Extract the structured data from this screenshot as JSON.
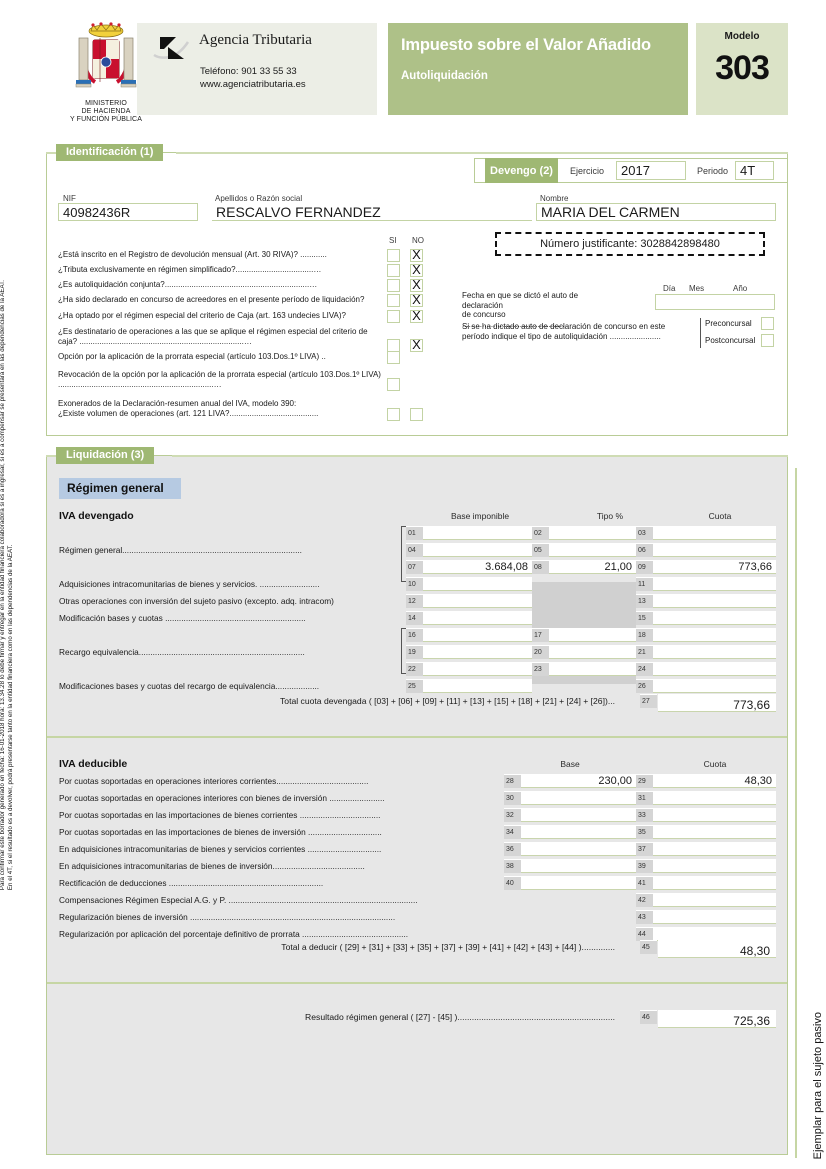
{
  "header": {
    "ministry": "MINISTERIO\nDE HACIENDA\nY FUNCIÓN PÚBLICA",
    "agency_name": "Agencia Tributaria",
    "agency_phone": "Teléfono: 901 33 55 33",
    "agency_web": "www.agenciatributaria.es",
    "title_main": "Impuesto sobre el Valor Añadido",
    "title_sub": "Autoliquidación",
    "modelo_label": "Modelo",
    "modelo_number": "303"
  },
  "identification": {
    "tab": "Identificación (1)",
    "nif_label": "NIF",
    "nif_value": "40982436R",
    "apellidos_label": "Apellidos o Razón social",
    "apellidos_value": "RESCALVO FERNANDEZ",
    "nombre_label": "Nombre",
    "nombre_value": "MARIA DEL CARMEN",
    "justificante": "Número justificante: 3028842898480",
    "si_label": "SI",
    "no_label": "NO",
    "questions": [
      {
        "text": "¿Está inscrito en el Registro de devolución mensual (Art. 30 RIVA)? ............",
        "si": "",
        "no": "X"
      },
      {
        "text": "¿Tributa exclusivamente en régimen simplificado?...................................…",
        "si": "",
        "no": "X"
      },
      {
        "text": "¿Es autoliquidación conjunta?.................................................................…",
        "si": "",
        "no": "X"
      },
      {
        "text": "¿Ha sido declarado en concurso de acreedores en el presente período de liquidación?",
        "si": "",
        "no": "X"
      },
      {
        "text": "¿Ha optado por el régimen especial del criterio de Caja (art. 163 undecies LIVA)?",
        "si": "",
        "no": "X"
      },
      {
        "text": "¿Es destinatario de operaciones a las que se aplique el régimen especial del criterio de caja? ..........................................................................…",
        "si": "",
        "no": "X"
      },
      {
        "text": "Opción por la aplicación de la prorrata especial (artículo 103.Dos.1º LIVA) ..",
        "si": "",
        "no": null
      },
      {
        "text": "Revocación de la opción por la aplicación de la prorrata especial (artículo 103.Dos.1º LIVA) ......................................................................…",
        "si": "",
        "no": null
      },
      {
        "text": "Exonerados de la Declaración-resumen anual del IVA, modelo 390:\n¿Existe volumen de operaciones (art. 121 LIVA?........................................",
        "si": "",
        "no": ""
      }
    ],
    "concurso_fecha_label": "Fecha en que se dictó el auto de declaración\nde concurso ..............................................",
    "dia_label": "Día",
    "mes_label": "Mes",
    "anio_label": "Año",
    "concurso_fecha_value": "",
    "concurso_tipo_label": "Si se ha dictado auto de declaración de concurso en este\nperíodo indique el tipo de autoliquidación .......................",
    "preconcursal_label": "Preconcursal",
    "postconcursal_label": "Postconcursal",
    "preconcursal_value": "",
    "postconcursal_value": ""
  },
  "devengo": {
    "tab": "Devengo (2)",
    "ejercicio_label": "Ejercicio",
    "ejercicio_value": "2017",
    "periodo_label": "Periodo",
    "periodo_value": "4T"
  },
  "liquidacion": {
    "tab": "Liquidación (3)",
    "regimen_general_header": "Régimen general",
    "devengado": {
      "title": "IVA devengado",
      "col_base": "Base imponible",
      "col_tipo": "Tipo %",
      "col_cuota": "Cuota",
      "rows": [
        {
          "label": "",
          "base_num": "01",
          "base": "",
          "tipo_num": "02",
          "tipo": "",
          "cuota_num": "03",
          "cuota": ""
        },
        {
          "label": "Régimen general..............................................................................",
          "base_num": "04",
          "base": "",
          "tipo_num": "05",
          "tipo": "",
          "cuota_num": "06",
          "cuota": ""
        },
        {
          "label": "",
          "base_num": "07",
          "base": "3.684,08",
          "tipo_num": "08",
          "tipo": "21,00",
          "cuota_num": "09",
          "cuota": "773,66"
        },
        {
          "label": "Adquisiciones intracomunitarias de bienes y servicios. ..........................",
          "base_num": "10",
          "base": "",
          "tipo_num": "",
          "tipo": "",
          "cuota_num": "11",
          "cuota": ""
        },
        {
          "label": "Otras operaciones con inversión del sujeto pasivo (excepto. adq. intracom)",
          "base_num": "12",
          "base": "",
          "tipo_num": "",
          "tipo": "",
          "cuota_num": "13",
          "cuota": ""
        },
        {
          "label": "Modificación bases y cuotas .............................................................",
          "base_num": "14",
          "base": "",
          "tipo_num": "",
          "tipo": "",
          "cuota_num": "15",
          "cuota": ""
        },
        {
          "label": "",
          "base_num": "16",
          "base": "",
          "tipo_num": "17",
          "tipo": "",
          "cuota_num": "18",
          "cuota": ""
        },
        {
          "label": "Recargo equivalencia........................................................................",
          "base_num": "19",
          "base": "",
          "tipo_num": "20",
          "tipo": "",
          "cuota_num": "21",
          "cuota": ""
        },
        {
          "label": "",
          "base_num": "22",
          "base": "",
          "tipo_num": "23",
          "tipo": "",
          "cuota_num": "24",
          "cuota": ""
        },
        {
          "label": "Modificaciones bases y cuotas del recargo de equivalencia...................",
          "base_num": "25",
          "base": "",
          "tipo_num": "",
          "tipo": "",
          "cuota_num": "26",
          "cuota": ""
        }
      ],
      "total_label": "Total cuota devengada ( [03] + [06] + [09] + [11] + [13] + [15] + [18] + [21] + [24] + [26])...",
      "total_num": "27",
      "total_value": "773,66"
    },
    "deducible": {
      "title": "IVA deducible",
      "col_base": "Base",
      "col_cuota": "Cuota",
      "rows": [
        {
          "label": "Por cuotas soportadas en operaciones interiores corrientes........................................",
          "base_num": "28",
          "base": "230,00",
          "cuota_num": "29",
          "cuota": "48,30"
        },
        {
          "label": "Por cuotas soportadas en operaciones interiores con bienes de inversión ........................",
          "base_num": "30",
          "base": "",
          "cuota_num": "31",
          "cuota": ""
        },
        {
          "label": "Por cuotas soportadas en las importaciones de bienes corrientes ...................................",
          "base_num": "32",
          "base": "",
          "cuota_num": "33",
          "cuota": ""
        },
        {
          "label": "Por cuotas soportadas en las importaciones de bienes de inversión ................................",
          "base_num": "34",
          "base": "",
          "cuota_num": "35",
          "cuota": ""
        },
        {
          "label": "En adquisiciones intracomunitarias de bienes y servicios corrientes ................................",
          "base_num": "36",
          "base": "",
          "cuota_num": "37",
          "cuota": ""
        },
        {
          "label": "En adquisiciones intracomunitarias de bienes de inversión........................................",
          "base_num": "38",
          "base": "",
          "cuota_num": "39",
          "cuota": ""
        },
        {
          "label": "Rectificación de deducciones ...................................................................",
          "base_num": "40",
          "base": "",
          "cuota_num": "41",
          "cuota": ""
        },
        {
          "label": "Compensaciones Régimen Especial A.G. y P. ..................................................................................",
          "base_num": "",
          "base": "",
          "cuota_num": "42",
          "cuota": ""
        },
        {
          "label": "Regularización bienes de inversión .........................................................................................",
          "base_num": "",
          "base": "",
          "cuota_num": "43",
          "cuota": ""
        },
        {
          "label": "Regularización por aplicación del porcentaje definitivo de prorrata ..............................................",
          "base_num": "",
          "base": "",
          "cuota_num": "44",
          "cuota": ""
        }
      ],
      "total_label": "Total a deducir ( [29] + [31] + [33] + [35] + [37] + [39] + [41] + [42] + [43] + [44] )..............",
      "total_num": "45",
      "total_value": "48,30"
    },
    "resultado": {
      "label": "Resultado régimen general ( [27] - [45] )..................................................................",
      "num": "46",
      "value": "725,36"
    }
  },
  "margins": {
    "left_note": "Para confirmar este borrador generado en fecha: 16-01-2018 hora: 13.34.28 lo debe firmar y entregar en la entidad financiera colaboradora si es a ingresar, si es a compensar se presentará en las dependencias de la AEAT.\nEn el 4T, si el resultado es a devolver, podrá presentarse tanto en la entidad financiera como en las dependencias de la AEAT.",
    "right_note": "Ejemplar para el sujeto pasivo"
  },
  "colors": {
    "green_tab": "#9fb873",
    "green_title": "#aec188",
    "green_modelo": "#dbe3c7",
    "blue_sub": "#b6cae2",
    "panel_grey": "#e7e7e7"
  }
}
